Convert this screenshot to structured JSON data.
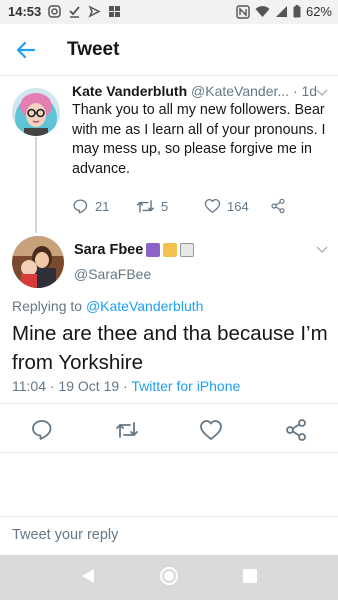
{
  "status_bar": {
    "time": "14:53",
    "battery": "62%",
    "icons": [
      "instagram-icon",
      "check-icon",
      "send-icon",
      "grid-icon",
      "nfc-icon",
      "wifi-icon",
      "signal-icon",
      "battery-icon"
    ]
  },
  "header": {
    "title": "Tweet",
    "back_icon": "arrow-left-icon"
  },
  "parent_tweet": {
    "name": "Kate Vanderbluth",
    "handle": "@KateVander...",
    "time": "· 1d",
    "text": "Thank you to all my new followers. Bear with me as I learn all of your pronouns. I may mess up, so please forgive me in advance.",
    "replies": "21",
    "retweets": "5",
    "likes": "164"
  },
  "main_tweet": {
    "name": "Sara Fbee",
    "name_emojis": [
      "star-of-david-emoji",
      "person-emoji",
      "music-score-emoji"
    ],
    "handle": "@SaraFBee",
    "replying_prefix": "Replying to",
    "replying_to": "@KateVanderbluth",
    "text": "Mine are thee and tha because I’m from Yorkshire",
    "timestamp": "11:04 · 19 Oct 19 ·",
    "source": "Twitter for iPhone"
  },
  "reply": {
    "placeholder": "Tweet your reply"
  },
  "colors": {
    "accent": "#1da1f2",
    "secondary_text": "#657786",
    "divider": "#e6ecf0"
  }
}
